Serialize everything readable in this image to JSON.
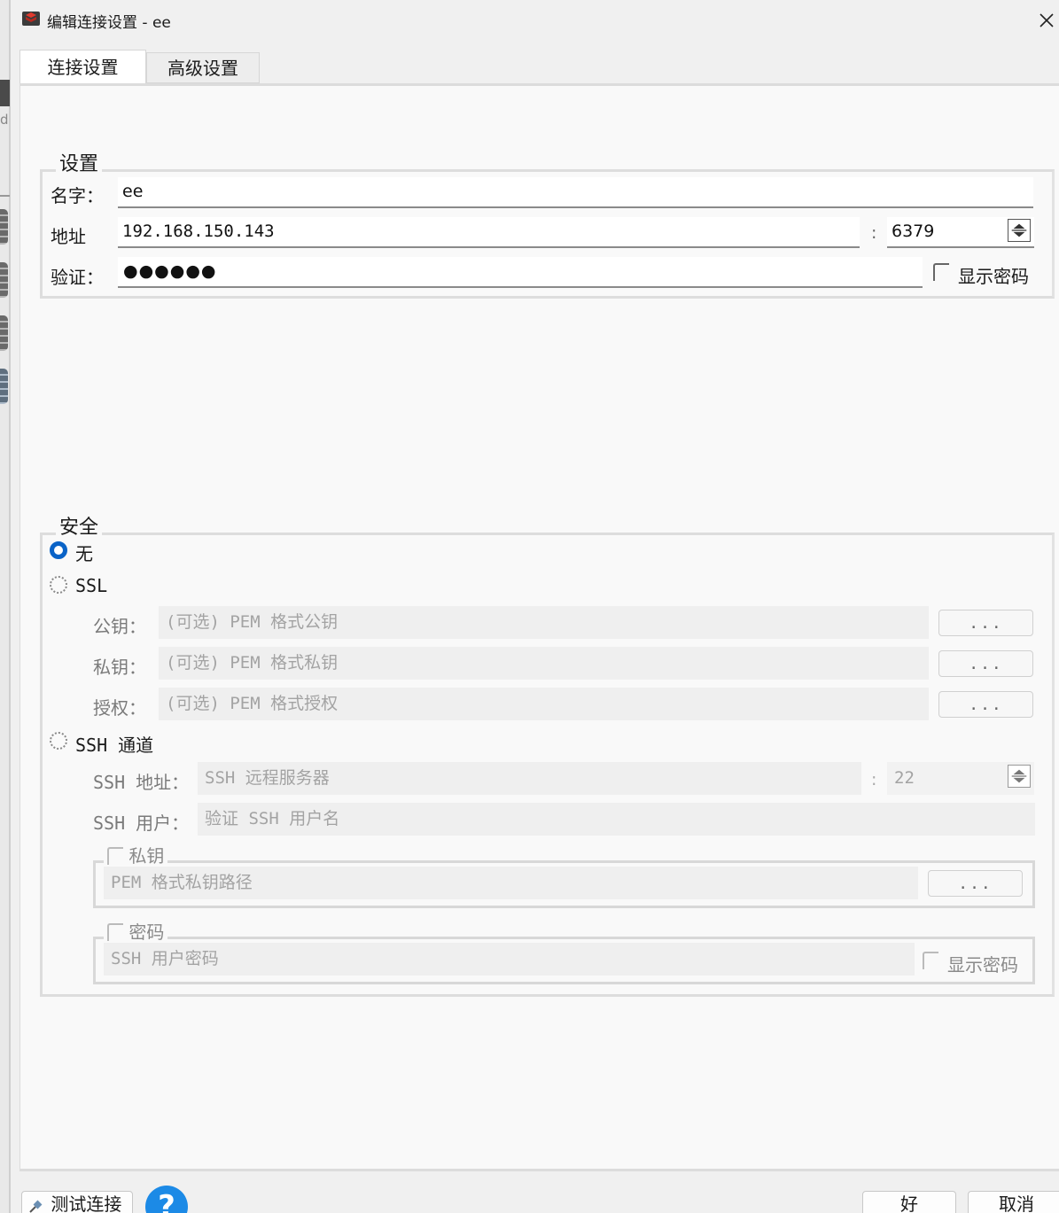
{
  "window": {
    "title": "编辑连接设置 - ee"
  },
  "tabs": [
    {
      "label": "连接设置",
      "active": true
    },
    {
      "label": "高级设置",
      "active": false
    }
  ],
  "settings": {
    "group_title": "设置",
    "name_label": "名字：",
    "name_value": "ee",
    "address_label": "地址",
    "address_value": "192.168.150.143",
    "port_separator": ":",
    "port_value": "6379",
    "auth_label": "验证：",
    "auth_masked": "●●●●●●",
    "show_password_label": "显示密码"
  },
  "security": {
    "group_title": "安全",
    "option_none": "无",
    "option_ssl": "SSL",
    "public_key_label": "公钥：",
    "public_key_placeholder": "(可选) PEM 格式公钥",
    "private_key_label": "私钥：",
    "private_key_placeholder": "(可选) PEM 格式私钥",
    "authority_label": "授权：",
    "authority_placeholder": "(可选) PEM 格式授权",
    "browse_label": "...",
    "option_ssh": "SSH 通道",
    "ssh_address_label": "SSH 地址：",
    "ssh_address_placeholder": "SSH 远程服务器",
    "ssh_port_separator": ":",
    "ssh_port_value": "22",
    "ssh_user_label": "SSH 用户：",
    "ssh_user_placeholder": "验证 SSH 用户名",
    "private_key_group": "私钥",
    "private_key_path_placeholder": "PEM 格式私钥路径",
    "password_group": "密码",
    "ssh_password_placeholder": "SSH 用户密码",
    "ssh_show_password_label": "显示密码"
  },
  "footer": {
    "test_connection_label": "测试连接",
    "help_symbol": "?",
    "ok_label": "好",
    "cancel_label": "取消"
  },
  "colors": {
    "accent": "#0a63c7",
    "help": "#1c8ae6",
    "panel": "#f9f9f9"
  }
}
